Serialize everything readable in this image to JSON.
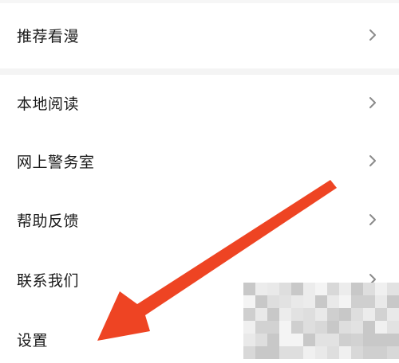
{
  "menu": {
    "items": [
      {
        "label": "推荐看漫",
        "icon": "chevron-right-icon"
      },
      {
        "label": "本地阅读",
        "icon": "chevron-right-icon"
      },
      {
        "label": "网上警务室",
        "icon": "chevron-right-icon"
      },
      {
        "label": "帮助反馈",
        "icon": "chevron-right-icon"
      },
      {
        "label": "联系我们",
        "icon": "chevron-right-icon"
      },
      {
        "label": "设置",
        "icon": ""
      }
    ]
  },
  "annotation": {
    "arrow_color": "#ee4423",
    "arrow_icon": "red-pointer-arrow"
  },
  "colors": {
    "text": "#1a1a1a",
    "chevron": "#8a8a8a",
    "background": "#ffffff",
    "section_gap": "#f4f4f4"
  }
}
